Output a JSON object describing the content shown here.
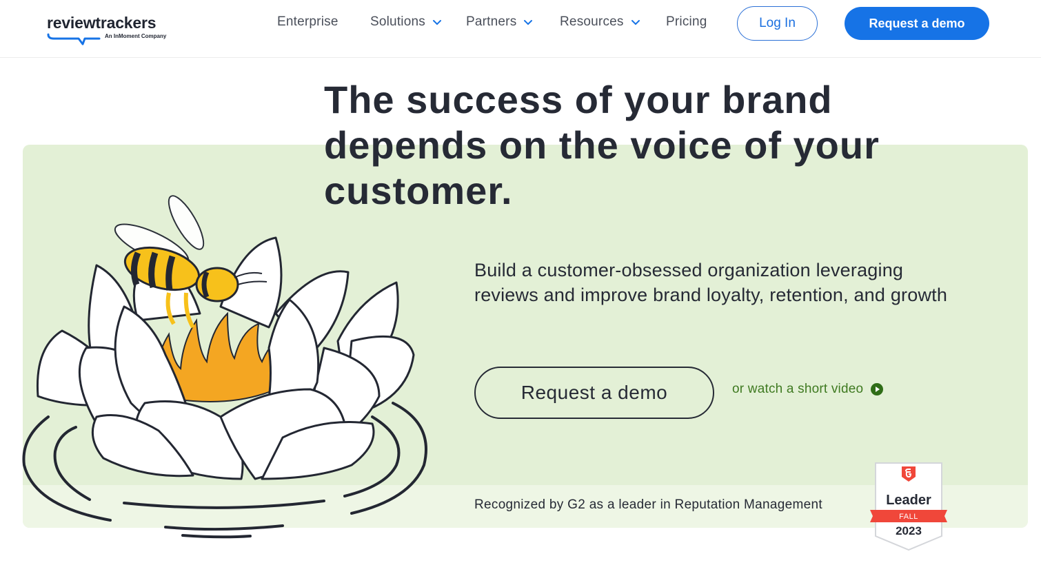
{
  "brand": {
    "logo_text": "reviewtrackers",
    "logo_subtext": "An InMoment Company",
    "accent_color": "#1673e6"
  },
  "nav": {
    "items": [
      {
        "label": "Enterprise",
        "has_dropdown": false
      },
      {
        "label": "Solutions",
        "has_dropdown": true
      },
      {
        "label": "Partners",
        "has_dropdown": true
      },
      {
        "label": "Resources",
        "has_dropdown": true
      },
      {
        "label": "Pricing",
        "has_dropdown": false
      }
    ],
    "login_label": "Log In",
    "demo_label": "Request a demo"
  },
  "hero": {
    "headline": "The success of your brand depends on the voice of your customer.",
    "subtext": "Build a customer-obsessed organization leveraging reviews and improve brand loyalty, retention, and growth",
    "cta_label": "Request a demo",
    "video_link_label": "or watch a short video",
    "recognition_text": "Recognized by G2 as a leader in Reputation Management",
    "background_color": "#e3f0d6"
  },
  "badge": {
    "title": "Leader",
    "season": "FALL",
    "year": "2023",
    "ribbon_color": "#f0473a"
  },
  "icons": {
    "dropdown": "chevron-down-icon",
    "play": "play-circle-icon",
    "g2": "g2-logo-icon"
  }
}
